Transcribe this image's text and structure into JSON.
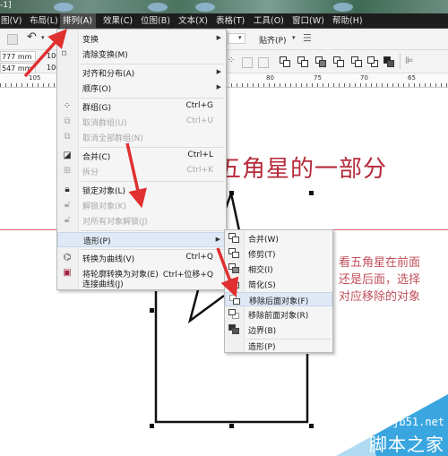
{
  "window": {
    "title_fragment": "-1]"
  },
  "menubar": {
    "items": [
      {
        "label": "图(V)"
      },
      {
        "label": "布局(L)"
      },
      {
        "label": "排列(A)",
        "active": true
      },
      {
        "label": "效果(C)"
      },
      {
        "label": "位图(B)"
      },
      {
        "label": "文本(X)"
      },
      {
        "label": "表格(T)"
      },
      {
        "label": "工具(O)"
      },
      {
        "label": "窗口(W)"
      },
      {
        "label": "帮助(H)"
      }
    ]
  },
  "toolbar": {
    "width_value": "777 mm",
    "height_value": "547 mm",
    "scale_x": "100",
    "scale_y": "100",
    "snap_label": "贴齐(P)"
  },
  "ruler": {
    "labels": [
      "105",
      "80",
      "75",
      "70",
      "65"
    ]
  },
  "arrange_menu": {
    "items": [
      {
        "label": "变换",
        "submenu": true
      },
      {
        "label": "清除变换(M)"
      },
      {
        "label": "对齐和分布(A)",
        "submenu": true
      },
      {
        "label": "顺序(O)",
        "submenu": true
      },
      {
        "label": "群组(G)",
        "shortcut": "Ctrl+G",
        "icon": "group-icon"
      },
      {
        "label": "取消群组(U)",
        "shortcut": "Ctrl+U",
        "disabled": true,
        "icon": "ungroup-icon"
      },
      {
        "label": "取消全部群组(N)",
        "disabled": true,
        "icon": "ungroup-all-icon"
      },
      {
        "label": "合并(C)",
        "shortcut": "Ctrl+L",
        "icon": "combine-icon"
      },
      {
        "label": "拆分",
        "shortcut": "Ctrl+K",
        "disabled": true,
        "icon": "break-apart-icon"
      },
      {
        "label": "锁定对象(L)",
        "icon": "lock-icon"
      },
      {
        "label": "解锁对象(K)",
        "disabled": true,
        "icon": "unlock-icon"
      },
      {
        "label": "对所有对象解锁(J)",
        "disabled": true,
        "icon": "unlock-all-icon"
      },
      {
        "label": "造形(P)",
        "submenu": true,
        "highlighted": true
      },
      {
        "label": "转换为曲线(V)",
        "shortcut": "Ctrl+Q",
        "icon": "convert-curves-icon"
      },
      {
        "label": "将轮廓转换为对象(E)",
        "shortcut": "Ctrl+位移+Q",
        "icon": "outline-to-object-icon"
      },
      {
        "label": "连接曲线(J)"
      }
    ]
  },
  "shaping_submenu": {
    "items": [
      {
        "label": "合并(W)",
        "icon": "weld-icon"
      },
      {
        "label": "修剪(T)",
        "icon": "trim-icon"
      },
      {
        "label": "相交(I)",
        "icon": "intersect-icon"
      },
      {
        "label": "简化(S)",
        "icon": "simplify-icon"
      },
      {
        "label": "移除后面对象(F)",
        "icon": "back-minus-front-icon",
        "highlighted": true
      },
      {
        "label": "移除前面对象(R)",
        "icon": "front-minus-back-icon"
      },
      {
        "label": "边界(B)",
        "icon": "boundary-icon"
      },
      {
        "label": "造形(P)"
      }
    ]
  },
  "annotations": {
    "heading": "五角星的一部分",
    "note_lines": [
      "看五角星在前面",
      "还是后面，选择",
      "对应移除的对象"
    ]
  },
  "watermark": {
    "site": "jb51.net",
    "name": "脚本之家"
  },
  "colors": {
    "annotation_red": "#b52a3a",
    "arrow_red": "#e03030",
    "watermark_blue": "#3aa6e0"
  }
}
